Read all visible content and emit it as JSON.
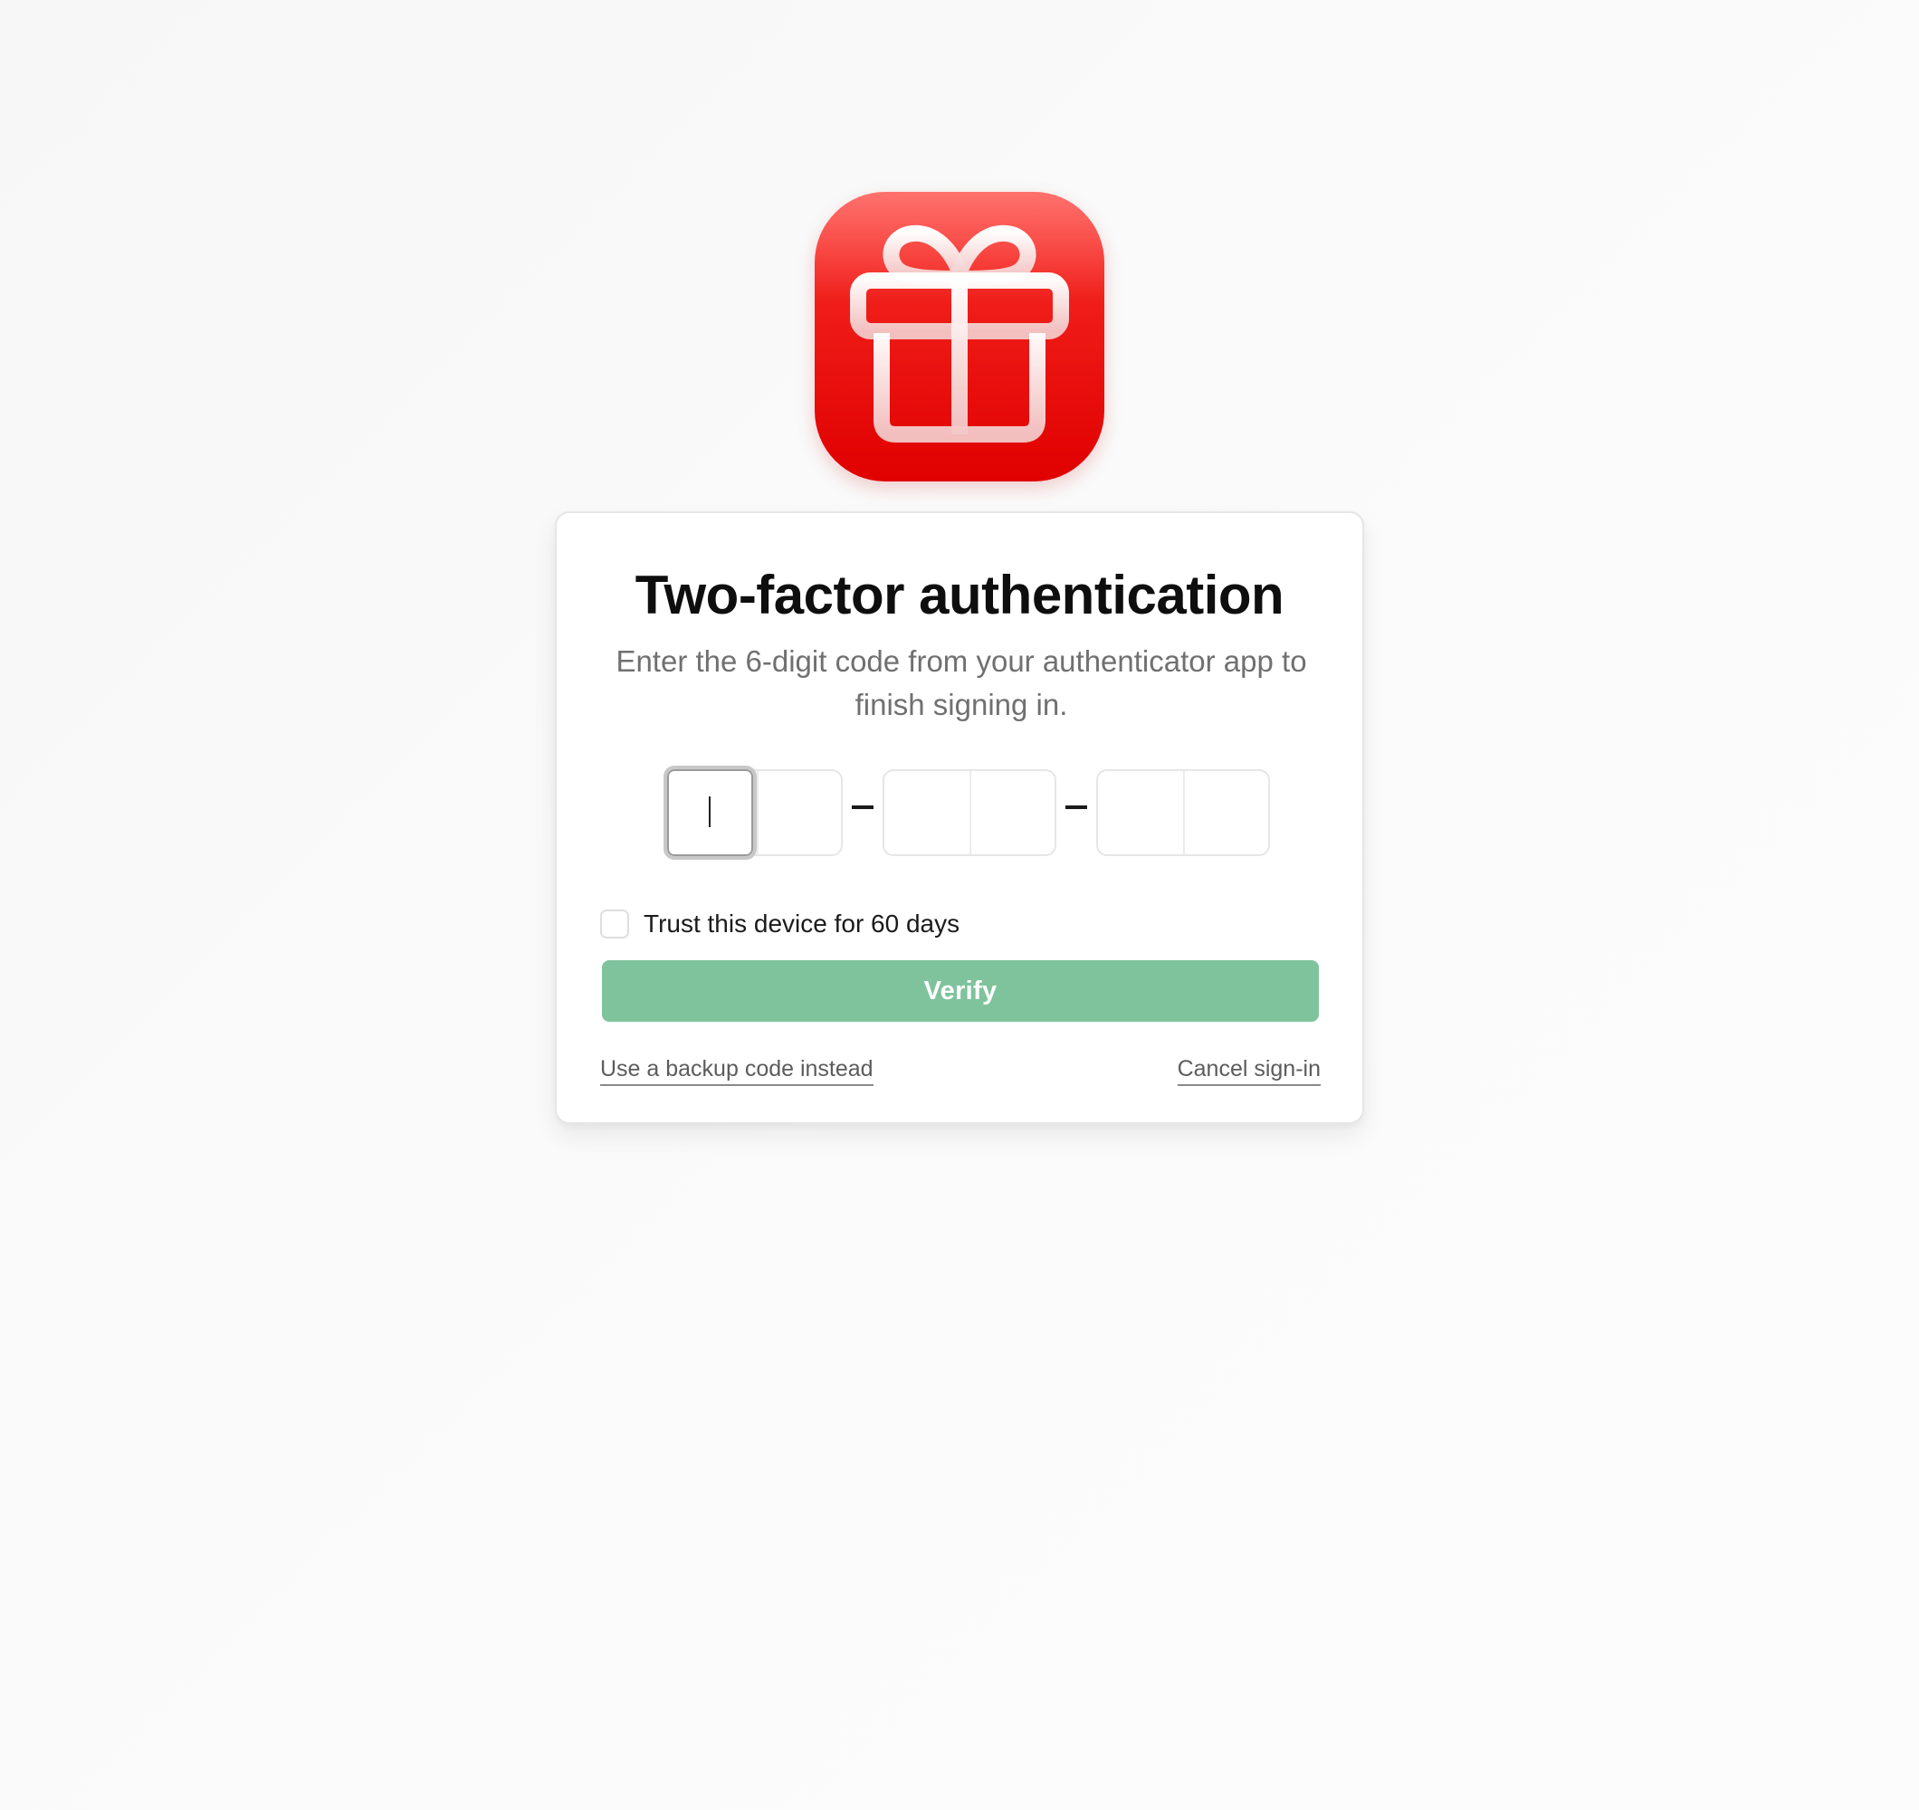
{
  "app": {
    "logo_icon": "gift-icon",
    "brand_color": "#e00000"
  },
  "auth": {
    "title": "Two-factor authentication",
    "subtitle": "Enter the 6-digit code from your authenticator app to finish signing in.",
    "code_digits": [
      "",
      "",
      "",
      "",
      "",
      ""
    ],
    "separator": "–",
    "trust_label": "Trust this device for 60 days",
    "trust_checked": false,
    "verify_label": "Verify",
    "verify_color": "#7fc39c",
    "backup_link": "Use a backup code instead",
    "cancel_link": "Cancel sign-in"
  }
}
